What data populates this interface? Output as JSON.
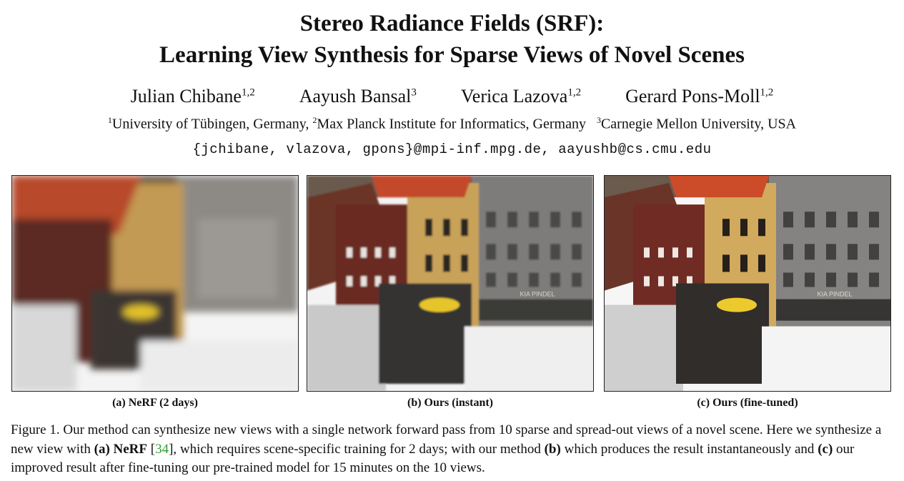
{
  "title_line1": "Stereo Radiance Fields (SRF):",
  "title_line2": "Learning View Synthesis for Sparse Views of Novel Scenes",
  "authors": [
    {
      "name": "Julian Chibane",
      "sup": "1,2"
    },
    {
      "name": "Aayush Bansal",
      "sup": "3"
    },
    {
      "name": "Verica Lazova",
      "sup": "1,2"
    },
    {
      "name": "Gerard Pons-Moll",
      "sup": "1,2"
    }
  ],
  "affiliations": {
    "a1_sup": "1",
    "a1": "University of Tübingen, Germany, ",
    "a2_sup": "2",
    "a2": "Max Planck Institute for Informatics, Germany",
    "a3_sup": "3",
    "a3": "Carnegie Mellon University, USA"
  },
  "emails": "{jchibane, vlazova, gpons}@mpi-inf.mpg.de, aayushb@cs.cmu.edu",
  "panels": [
    {
      "caption": "(a) NeRF (2 days)",
      "shop_sign": ""
    },
    {
      "caption": "(b) Ours (instant)",
      "shop_sign": "KIA PINDEL"
    },
    {
      "caption": "(c) Ours (fine-tuned)",
      "shop_sign": "KIA PINDEL"
    }
  ],
  "figure_caption": {
    "label": "Figure 1.",
    "t1": " Our method can synthesize new views with a single network forward pass from 10 sparse and spread-out views of a novel scene. Here we synthesize a new view with ",
    "b1": "(a) NeRF",
    "t2": " [",
    "ref": "34",
    "t3": "], which requires scene-specific training for 2 days; with our method ",
    "b2": "(b)",
    "t4": " which produces the result instantaneously and ",
    "b3": "(c)",
    "t5": " our improved result after fine-tuning our pre-trained model for 15 minutes on the 10 views."
  }
}
